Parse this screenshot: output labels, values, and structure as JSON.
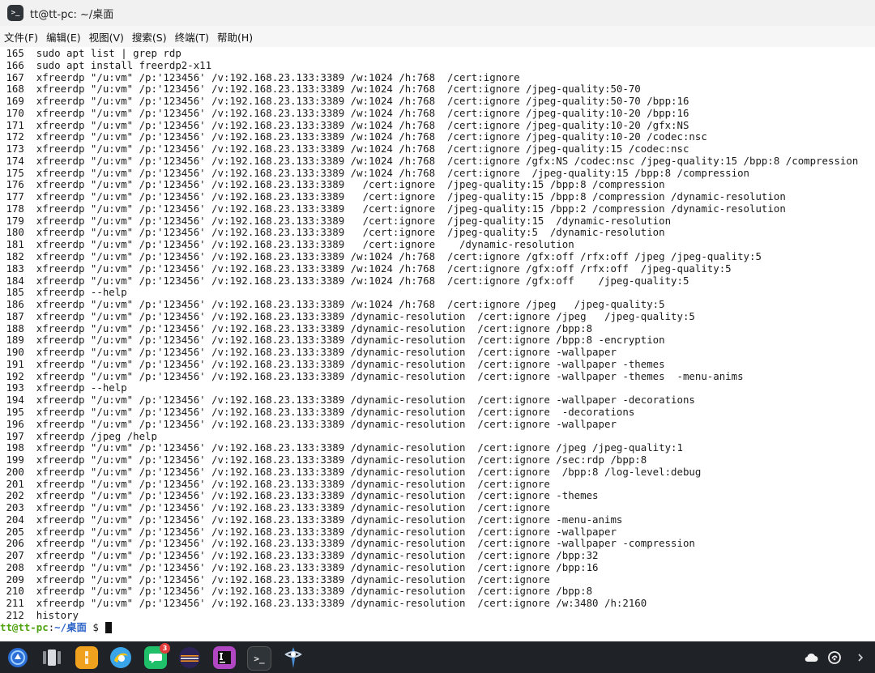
{
  "window": {
    "title": "tt@tt-pc: ~/桌面"
  },
  "menu": [
    "文件(F)",
    "编辑(E)",
    "视图(V)",
    "搜索(S)",
    "终端(T)",
    "帮助(H)"
  ],
  "terminal": {
    "lines": [
      " 165  sudo apt list | grep rdp",
      " 166  sudo apt install freerdp2-x11",
      " 167  xfreerdp \"/u:vm\" /p:'123456' /v:192.168.23.133:3389 /w:1024 /h:768  /cert:ignore",
      " 168  xfreerdp \"/u:vm\" /p:'123456' /v:192.168.23.133:3389 /w:1024 /h:768  /cert:ignore /jpeg-quality:50-70",
      " 169  xfreerdp \"/u:vm\" /p:'123456' /v:192.168.23.133:3389 /w:1024 /h:768  /cert:ignore /jpeg-quality:50-70 /bpp:16",
      " 170  xfreerdp \"/u:vm\" /p:'123456' /v:192.168.23.133:3389 /w:1024 /h:768  /cert:ignore /jpeg-quality:10-20 /bpp:16",
      " 171  xfreerdp \"/u:vm\" /p:'123456' /v:192.168.23.133:3389 /w:1024 /h:768  /cert:ignore /jpeg-quality:10-20 /gfx:NS",
      " 172  xfreerdp \"/u:vm\" /p:'123456' /v:192.168.23.133:3389 /w:1024 /h:768  /cert:ignore /jpeg-quality:10-20 /codec:nsc",
      " 173  xfreerdp \"/u:vm\" /p:'123456' /v:192.168.23.133:3389 /w:1024 /h:768  /cert:ignore /jpeg-quality:15 /codec:nsc",
      " 174  xfreerdp \"/u:vm\" /p:'123456' /v:192.168.23.133:3389 /w:1024 /h:768  /cert:ignore /gfx:NS /codec:nsc /jpeg-quality:15 /bpp:8 /compression",
      " 175  xfreerdp \"/u:vm\" /p:'123456' /v:192.168.23.133:3389 /w:1024 /h:768  /cert:ignore  /jpeg-quality:15 /bpp:8 /compression",
      " 176  xfreerdp \"/u:vm\" /p:'123456' /v:192.168.23.133:3389   /cert:ignore  /jpeg-quality:15 /bpp:8 /compression",
      " 177  xfreerdp \"/u:vm\" /p:'123456' /v:192.168.23.133:3389   /cert:ignore  /jpeg-quality:15 /bpp:8 /compression /dynamic-resolution",
      " 178  xfreerdp \"/u:vm\" /p:'123456' /v:192.168.23.133:3389   /cert:ignore  /jpeg-quality:15 /bpp:2 /compression /dynamic-resolution",
      " 179  xfreerdp \"/u:vm\" /p:'123456' /v:192.168.23.133:3389   /cert:ignore  /jpeg-quality:15  /dynamic-resolution",
      " 180  xfreerdp \"/u:vm\" /p:'123456' /v:192.168.23.133:3389   /cert:ignore  /jpeg-quality:5  /dynamic-resolution",
      " 181  xfreerdp \"/u:vm\" /p:'123456' /v:192.168.23.133:3389   /cert:ignore    /dynamic-resolution",
      " 182  xfreerdp \"/u:vm\" /p:'123456' /v:192.168.23.133:3389 /w:1024 /h:768  /cert:ignore /gfx:off /rfx:off /jpeg /jpeg-quality:5",
      " 183  xfreerdp \"/u:vm\" /p:'123456' /v:192.168.23.133:3389 /w:1024 /h:768  /cert:ignore /gfx:off /rfx:off  /jpeg-quality:5",
      " 184  xfreerdp \"/u:vm\" /p:'123456' /v:192.168.23.133:3389 /w:1024 /h:768  /cert:ignore /gfx:off    /jpeg-quality:5",
      " 185  xfreerdp --help",
      " 186  xfreerdp \"/u:vm\" /p:'123456' /v:192.168.23.133:3389 /w:1024 /h:768  /cert:ignore /jpeg   /jpeg-quality:5",
      " 187  xfreerdp \"/u:vm\" /p:'123456' /v:192.168.23.133:3389 /dynamic-resolution  /cert:ignore /jpeg   /jpeg-quality:5",
      " 188  xfreerdp \"/u:vm\" /p:'123456' /v:192.168.23.133:3389 /dynamic-resolution  /cert:ignore /bpp:8",
      " 189  xfreerdp \"/u:vm\" /p:'123456' /v:192.168.23.133:3389 /dynamic-resolution  /cert:ignore /bpp:8 -encryption",
      " 190  xfreerdp \"/u:vm\" /p:'123456' /v:192.168.23.133:3389 /dynamic-resolution  /cert:ignore -wallpaper",
      " 191  xfreerdp \"/u:vm\" /p:'123456' /v:192.168.23.133:3389 /dynamic-resolution  /cert:ignore -wallpaper -themes",
      " 192  xfreerdp \"/u:vm\" /p:'123456' /v:192.168.23.133:3389 /dynamic-resolution  /cert:ignore -wallpaper -themes  -menu-anims",
      " 193  xfreerdp --help",
      " 194  xfreerdp \"/u:vm\" /p:'123456' /v:192.168.23.133:3389 /dynamic-resolution  /cert:ignore -wallpaper -decorations",
      " 195  xfreerdp \"/u:vm\" /p:'123456' /v:192.168.23.133:3389 /dynamic-resolution  /cert:ignore  -decorations",
      " 196  xfreerdp \"/u:vm\" /p:'123456' /v:192.168.23.133:3389 /dynamic-resolution  /cert:ignore -wallpaper",
      " 197  xfreerdp /jpeg /help",
      " 198  xfreerdp \"/u:vm\" /p:'123456' /v:192.168.23.133:3389 /dynamic-resolution  /cert:ignore /jpeg /jpeg-quality:1",
      " 199  xfreerdp \"/u:vm\" /p:'123456' /v:192.168.23.133:3389 /dynamic-resolution  /cert:ignore /sec:rdp /bpp:8",
      " 200  xfreerdp \"/u:vm\" /p:'123456' /v:192.168.23.133:3389 /dynamic-resolution  /cert:ignore  /bpp:8 /log-level:debug",
      " 201  xfreerdp \"/u:vm\" /p:'123456' /v:192.168.23.133:3389 /dynamic-resolution  /cert:ignore",
      " 202  xfreerdp \"/u:vm\" /p:'123456' /v:192.168.23.133:3389 /dynamic-resolution  /cert:ignore -themes",
      " 203  xfreerdp \"/u:vm\" /p:'123456' /v:192.168.23.133:3389 /dynamic-resolution  /cert:ignore",
      " 204  xfreerdp \"/u:vm\" /p:'123456' /v:192.168.23.133:3389 /dynamic-resolution  /cert:ignore -menu-anims",
      " 205  xfreerdp \"/u:vm\" /p:'123456' /v:192.168.23.133:3389 /dynamic-resolution  /cert:ignore -wallpaper",
      " 206  xfreerdp \"/u:vm\" /p:'123456' /v:192.168.23.133:3389 /dynamic-resolution  /cert:ignore -wallpaper -compression",
      " 207  xfreerdp \"/u:vm\" /p:'123456' /v:192.168.23.133:3389 /dynamic-resolution  /cert:ignore /bpp:32",
      " 208  xfreerdp \"/u:vm\" /p:'123456' /v:192.168.23.133:3389 /dynamic-resolution  /cert:ignore /bpp:16",
      " 209  xfreerdp \"/u:vm\" /p:'123456' /v:192.168.23.133:3389 /dynamic-resolution  /cert:ignore",
      " 210  xfreerdp \"/u:vm\" /p:'123456' /v:192.168.23.133:3389 /dynamic-resolution  /cert:ignore /bpp:8",
      " 211  xfreerdp \"/u:vm\" /p:'123456' /v:192.168.23.133:3389 /dynamic-resolution  /cert:ignore /w:3480 /h:2160",
      " 212  history"
    ],
    "prompt": {
      "user": "tt@tt-pc",
      "sep": ":",
      "path": "~/桌面",
      "dollar": " $ "
    },
    "colors": {
      "user": "#4ea30e",
      "path": "#2d64c8",
      "text": "#1a1a1a"
    }
  },
  "taskbar": {
    "apps": [
      {
        "name": "launcher-icon"
      },
      {
        "name": "multitask-view-icon"
      },
      {
        "name": "file-manager-icon"
      },
      {
        "name": "browser-icon"
      },
      {
        "name": "chat-icon",
        "badge": "3"
      },
      {
        "name": "eclipse-ide-icon"
      },
      {
        "name": "intellij-idea-icon"
      },
      {
        "name": "terminal-icon"
      },
      {
        "name": "app-icon"
      }
    ],
    "tray": [
      "cloud-icon",
      "power-icon",
      "chevron-right-icon"
    ],
    "colors": {
      "bar": "#1f2328"
    }
  }
}
